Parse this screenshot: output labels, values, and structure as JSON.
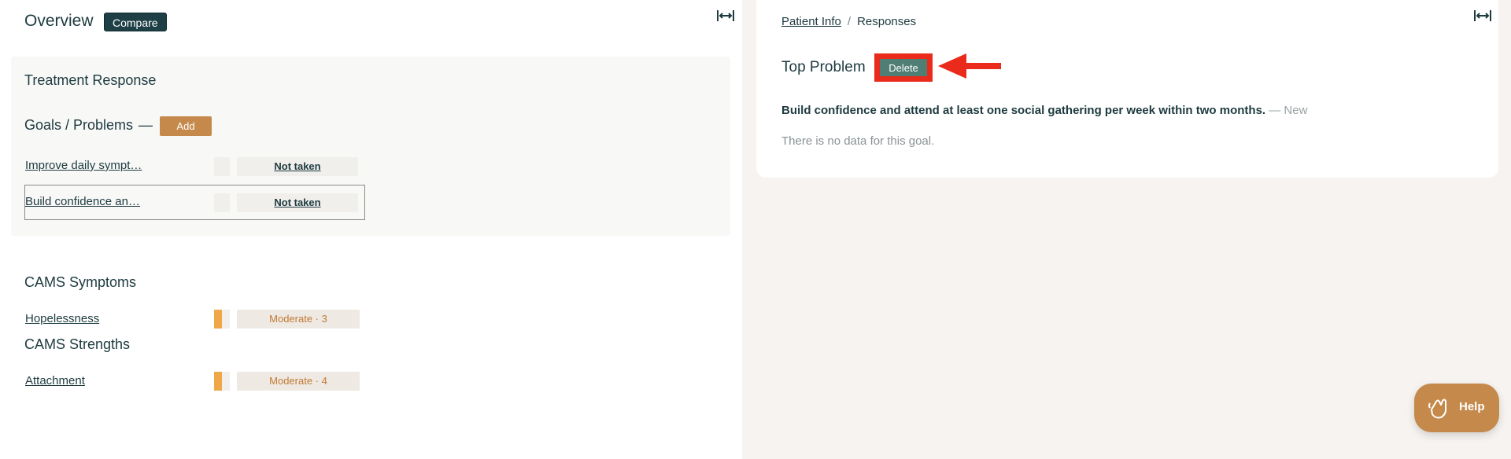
{
  "overview": {
    "title": "Overview",
    "compare_label": "Compare"
  },
  "treatment": {
    "title": "Treatment Response",
    "goals_title": "Goals / Problems",
    "goals_dash": "—",
    "add_label": "Add",
    "goals": [
      {
        "label": "Improve daily sympt…",
        "status": "Not taken"
      },
      {
        "label": "Build confidence an…",
        "status": "Not taken"
      }
    ]
  },
  "cams_symptoms": {
    "title": "CAMS Symptoms",
    "items": [
      {
        "label": "Hopelessness",
        "score": "Moderate · 3"
      }
    ]
  },
  "cams_strengths": {
    "title": "CAMS Strengths",
    "items": [
      {
        "label": "Attachment",
        "score": "Moderate · 4"
      }
    ]
  },
  "breadcrumb": {
    "parent": "Patient Info",
    "separator": "/",
    "current": "Responses"
  },
  "detail": {
    "title": "Top Problem",
    "delete_label": "Delete",
    "goal_text": "Build confidence and attend at least one social gathering per week within two months.",
    "goal_status": " — New",
    "empty_text": "There is no data for this goal."
  },
  "help": {
    "label": "Help"
  },
  "colors": {
    "accent": "#c58a4b",
    "dark": "#1e3f45",
    "delete": "#4f7f74",
    "highlight": "#ea2a1a",
    "moderate": "#f0a748"
  }
}
